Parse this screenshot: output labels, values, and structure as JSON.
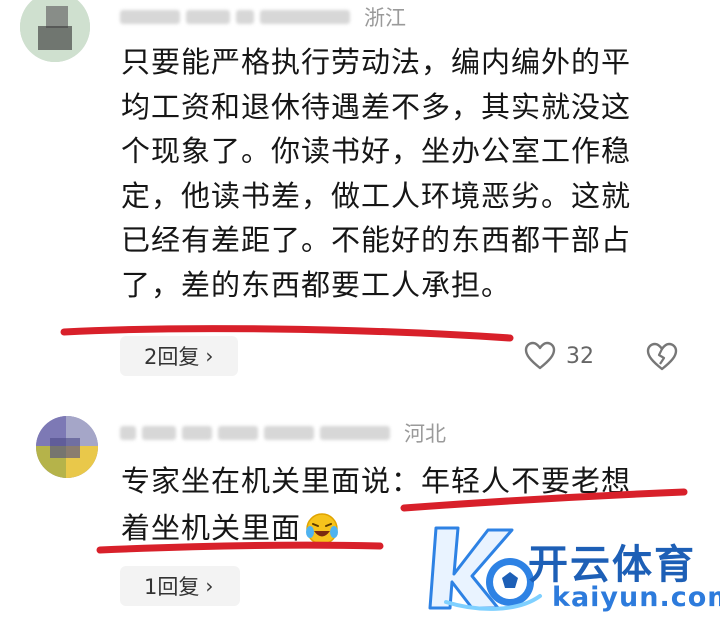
{
  "comments": [
    {
      "location": "浙江",
      "lines": [
        "只要能严格执行劳动法，编内编外的平",
        "均工资和退休待遇差不多，其实就没这",
        "个现象了。你读书好，坐办公室工作稳",
        "定，他读书差，做工人环境恶劣。这就",
        "已经有差距了。不能好的东西都干部占",
        "了，差的东西都要工人承担。"
      ],
      "reply_label": "2回复",
      "likes": "32"
    },
    {
      "location": "河北",
      "lines": [
        "专家坐在机关里面说：年轻人不要老想",
        "着坐机关里面"
      ],
      "emoji": "laughing-crying-emoji",
      "reply_label": "1回复"
    }
  ],
  "watermark": {
    "title": "开云体育",
    "url": "kaiyun.com"
  },
  "colors": {
    "underline": "#d8202a",
    "brand": "#1d5fb6"
  }
}
